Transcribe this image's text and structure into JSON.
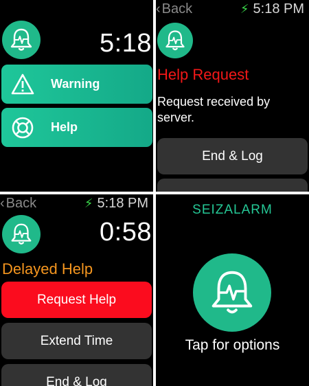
{
  "colors": {
    "accent_green": "#20b98a",
    "brand_green": "#25c896",
    "alert_red": "#f21818",
    "button_red": "#fb0c1e",
    "delay_orange": "#f5961f",
    "button_gray": "#333333",
    "bolt_green": "#3ad64a"
  },
  "home": {
    "app_icon": "bell-heartbeat-icon",
    "clock": "5:18",
    "buttons": [
      {
        "label": "Warning",
        "icon": "warning-triangle-icon"
      },
      {
        "label": "Help",
        "icon": "lifebuoy-icon"
      }
    ]
  },
  "help_request": {
    "back_label": "Back",
    "status_time": "5:18 PM",
    "title": "Help Request",
    "message": "Request received by server.",
    "end_button": "End & Log"
  },
  "delayed_help": {
    "back_label": "Back",
    "status_time": "5:18 PM",
    "countdown": "0:58",
    "title": "Delayed Help",
    "request_button": "Request Help",
    "extend_button": "Extend Time",
    "end_button": "End & Log"
  },
  "launch": {
    "brand": "SEIZALARM",
    "prompt": "Tap for options"
  }
}
